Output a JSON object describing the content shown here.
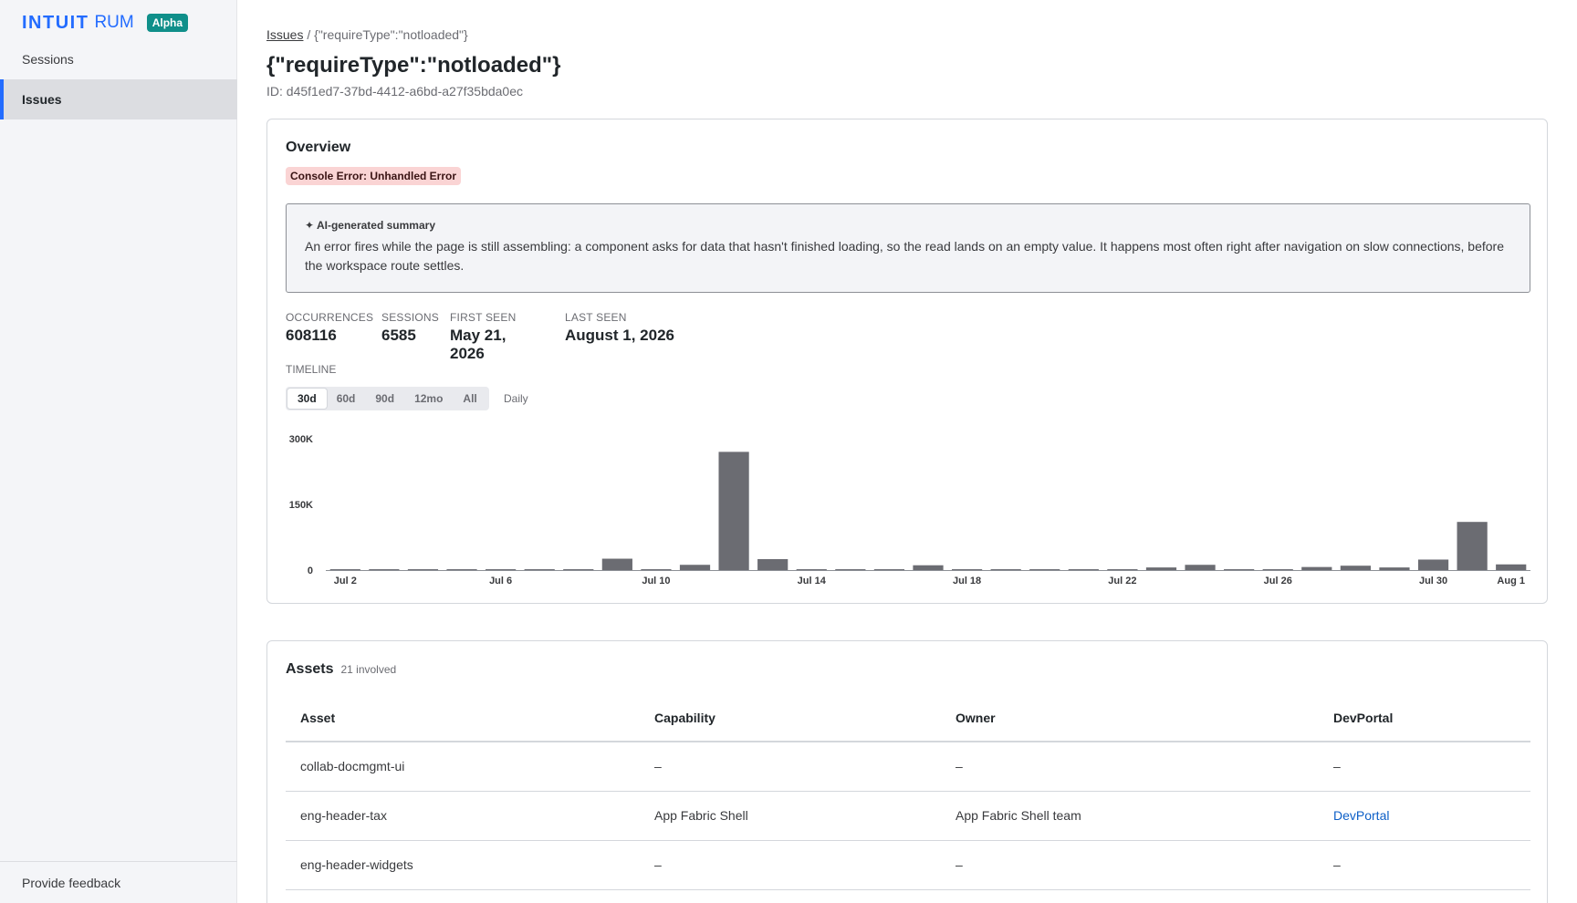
{
  "brand": {
    "name": "INTUIT",
    "product": "RUM",
    "badge": "Alpha",
    "color": "#236cff"
  },
  "sidebar": {
    "items": [
      {
        "label": "Sessions",
        "active": false
      },
      {
        "label": "Issues",
        "active": true
      }
    ],
    "footer": "Provide feedback"
  },
  "breadcrumb": {
    "parent": "Issues",
    "separator": " / ",
    "current": "{\"requireType\":\"notloaded\"}"
  },
  "page": {
    "title": "{\"requireType\":\"notloaded\"}",
    "id_text": "ID: d45f1ed7-37bd-4412-a6bd-a27f35bda0ec"
  },
  "overview": {
    "title": "Overview",
    "error_tag": "Console Error: Unhandled Error",
    "summary_label": "✦ AI-generated summary",
    "summary_text": "An error fires while the page is still assembling: a component asks for data that hasn't finished loading, so the read lands on an empty value. It happens most often right after navigation on slow connections, before the workspace route settles.",
    "stats": [
      {
        "label": "OCCURRENCES",
        "value": "608116"
      },
      {
        "label": "SESSIONS",
        "value": "6585"
      },
      {
        "label": "FIRST SEEN",
        "value": "May 21, 2026"
      },
      {
        "label": "LAST SEEN",
        "value": "August 1, 2026"
      }
    ],
    "timeline_label": "TIMELINE",
    "ranges": [
      {
        "label": "30d",
        "active": true
      },
      {
        "label": "60d",
        "active": false
      },
      {
        "label": "90d",
        "active": false
      },
      {
        "label": "12mo",
        "active": false
      },
      {
        "label": "All",
        "active": false
      }
    ],
    "granularity": "Daily"
  },
  "chart_data": {
    "type": "bar",
    "categories": [
      "Jul 2",
      "Jul 3",
      "Jul 4",
      "Jul 5",
      "Jul 6",
      "Jul 7",
      "Jul 8",
      "Jul 9",
      "Jul 10",
      "Jul 11",
      "Jul 12",
      "Jul 13",
      "Jul 14",
      "Jul 15",
      "Jul 16",
      "Jul 17",
      "Jul 18",
      "Jul 19",
      "Jul 20",
      "Jul 21",
      "Jul 22",
      "Jul 23",
      "Jul 24",
      "Jul 25",
      "Jul 26",
      "Jul 27",
      "Jul 28",
      "Jul 29",
      "Jul 30",
      "Jul 31",
      "Aug 1"
    ],
    "x_tick_labels": [
      "Jul 2",
      "Jul 6",
      "Jul 10",
      "Jul 14",
      "Jul 18",
      "Jul 22",
      "Jul 26",
      "Jul 30",
      "Aug 1"
    ],
    "values": [
      2000,
      2000,
      2000,
      2000,
      2000,
      2000,
      2000,
      26000,
      2000,
      12000,
      270000,
      25000,
      2000,
      2000,
      2000,
      11000,
      2000,
      2000,
      2000,
      2000,
      2000,
      6000,
      12000,
      2000,
      2000,
      7000,
      10000,
      6000,
      24000,
      110000,
      13000
    ],
    "y_ticks": [
      0,
      150000,
      300000
    ],
    "y_tick_labels": [
      "0",
      "150K",
      "300K"
    ],
    "ylim": [
      0,
      300000
    ],
    "bar_color": "#6b6c72",
    "title": "",
    "xlabel": "",
    "ylabel": ""
  },
  "assets": {
    "title": "Assets",
    "count_text": "21 involved",
    "columns": [
      "Asset",
      "Capability",
      "Owner",
      "DevPortal"
    ],
    "rows": [
      {
        "asset": "collab-docmgmt-ui",
        "capability": "–",
        "owner": "–",
        "devportal": "–",
        "devportal_link": false
      },
      {
        "asset": "eng-header-tax",
        "capability": "App Fabric Shell",
        "owner": "App Fabric Shell team",
        "devportal": "DevPortal",
        "devportal_link": true
      },
      {
        "asset": "eng-header-widgets",
        "capability": "–",
        "owner": "–",
        "devportal": "–",
        "devportal_link": false
      }
    ]
  }
}
